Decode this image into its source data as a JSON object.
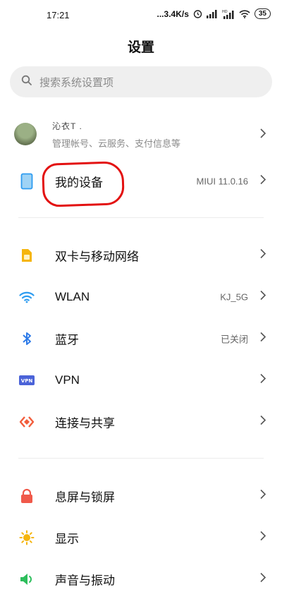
{
  "status_bar": {
    "time": "17:21",
    "network_speed": "...3.4K/s",
    "battery": "35",
    "signal_hd": "HD"
  },
  "title": "设置",
  "search": {
    "placeholder": "搜索系统设置项"
  },
  "account": {
    "name": "沁衣T .",
    "subtitle": "管理帐号、云服务、支付信息等"
  },
  "device": {
    "label": "我的设备",
    "value": "MIUI 11.0.16"
  },
  "network_items": [
    {
      "label": "双卡与移动网络",
      "value": "",
      "icon": "sim-card-icon",
      "color": "#F5B50E"
    },
    {
      "label": "WLAN",
      "value": "KJ_5G",
      "icon": "wifi-icon",
      "color": "#2E9CF0"
    },
    {
      "label": "蓝牙",
      "value": "已关闭",
      "icon": "bluetooth-icon",
      "color": "#2E7BE8"
    },
    {
      "label": "VPN",
      "value": "",
      "icon": "vpn-icon",
      "color": "#4B63D8"
    },
    {
      "label": "连接与共享",
      "value": "",
      "icon": "connection-share-icon",
      "color": "#F25C3B"
    }
  ],
  "display_items": [
    {
      "label": "息屏与锁屏",
      "icon": "lock-icon",
      "color": "#F0594A"
    },
    {
      "label": "显示",
      "icon": "brightness-icon",
      "color": "#F5B50E"
    },
    {
      "label": "声音与振动",
      "icon": "speaker-icon",
      "color": "#2DBE5C"
    }
  ],
  "vpn_badge": "VPN"
}
